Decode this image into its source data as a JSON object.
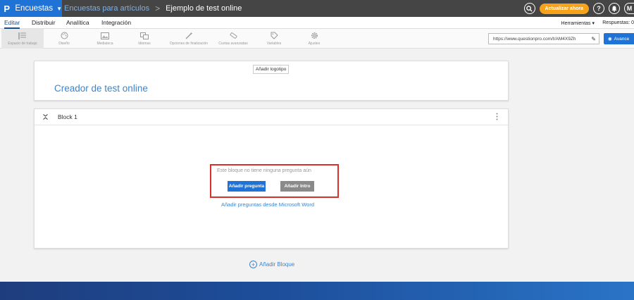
{
  "topbar": {
    "app_name": "Encuestas",
    "app_icon": "P",
    "breadcrumb_folder": "Encuestas para artículos",
    "breadcrumb_separator": ">",
    "breadcrumb_survey": "Ejemplo de test online",
    "upgrade_label": "Actualizar ahora",
    "help_icon": "?",
    "user_icon": "M",
    "colors": {
      "bar": "#454545",
      "brand": "#1f73d6",
      "upgrade": "#f7a21b"
    }
  },
  "menubar": {
    "items": [
      "Editar",
      "Distribuir",
      "Analítica",
      "Integración"
    ],
    "tools_label": "Herramientas",
    "responses_label": "Respuestas: 0"
  },
  "toolbar": {
    "tools": [
      {
        "label": "Espacio de trabajo",
        "icon": "workspace-icon"
      },
      {
        "label": "Diseño",
        "icon": "palette-icon"
      },
      {
        "label": "Mediateca",
        "icon": "media-icon"
      },
      {
        "label": "Idiomas",
        "icon": "languages-icon"
      },
      {
        "label": "Opciones de finalización",
        "icon": "wand-icon"
      },
      {
        "label": "Cuotas avanzadas",
        "icon": "quota-icon"
      },
      {
        "label": "Variables",
        "icon": "tag-icon"
      },
      {
        "label": "Ajustes",
        "icon": "gear-icon"
      }
    ],
    "url": "https://www.questionpro.com/t/AM4X9Zh",
    "advance_label": "Avance"
  },
  "title_card": {
    "add_logo_label": "Añadir logotipo",
    "survey_title": "Creador de test online"
  },
  "block": {
    "name": "Block 1",
    "empty_message": "Este bloque no tiene ninguna pregunta aún",
    "add_question_label": "Añadir pregunta",
    "add_intro_label": "Añadir Intro",
    "word_link": "Añadir preguntas desde Microsoft Word"
  },
  "add_block_label": "Añadir Bloque"
}
